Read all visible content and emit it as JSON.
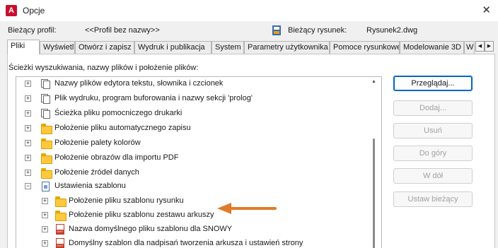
{
  "window": {
    "title": "Opcje",
    "app_icon": "A"
  },
  "profile": {
    "current_profile_label": "Bieżący profil:",
    "current_profile_value": "<<Profil bez nazwy>>",
    "current_drawing_label": "Bieżący rysunek:",
    "current_drawing_value": "Rysunek2.dwg"
  },
  "tabs": [
    "Pliki",
    "Wyświetl",
    "Otwórz i zapisz",
    "Wydruk i publikacja",
    "System",
    "Parametry użytkownika",
    "Pomoce rysunkowe",
    "Modelowanie 3D",
    "W"
  ],
  "active_tab": "Pliki",
  "panel": {
    "label": "Ścieżki wyszukiwania, nazwy plików i położenie plików:"
  },
  "tree": [
    {
      "label": "Nazwy plików edytora tekstu, słownika i czcionek",
      "icon": "doc-stack-icon",
      "level": 0,
      "expander": "+"
    },
    {
      "label": "Plik wydruku, program buforowania i nazwy sekcji 'prolog'",
      "icon": "doc-stack-icon",
      "level": 0,
      "expander": "+"
    },
    {
      "label": "Ścieżka pliku pomocniczego drukarki",
      "icon": "doc-stack-icon",
      "level": 0,
      "expander": "+"
    },
    {
      "label": "Położenie pliku automatycznego zapisu",
      "icon": "folder-icon",
      "level": 0,
      "expander": "+"
    },
    {
      "label": "Położenie palety kolorów",
      "icon": "folder-icon",
      "level": 0,
      "expander": "+"
    },
    {
      "label": "Położenie obrazów dla importu PDF",
      "icon": "folder-icon",
      "level": 0,
      "expander": "+"
    },
    {
      "label": "Położenie źródeł danych",
      "icon": "folder-icon",
      "level": 0,
      "expander": "+"
    },
    {
      "label": "Ustawienia szablonu",
      "icon": "template-doc-icon",
      "level": 0,
      "expander": "−"
    },
    {
      "label": "Położenie pliku szablonu rysunku",
      "icon": "folder-icon",
      "level": 1,
      "expander": "+"
    },
    {
      "label": "Położenie pliku szablonu zestawu arkuszy",
      "icon": "folder-icon",
      "level": 1,
      "expander": "+"
    },
    {
      "label": "Nazwa domyślnego pliku szablonu dla SNOWY",
      "icon": "dwt-file-icon",
      "level": 1,
      "expander": "+"
    },
    {
      "label": "Domyślny szablon dla nadpisań tworzenia arkusza i ustawień strony",
      "icon": "dwt-file-icon",
      "level": 1,
      "expander": "+"
    }
  ],
  "buttons": [
    {
      "label": "Przeglądaj...",
      "enabled": true
    },
    {
      "label": "Dodaj...",
      "enabled": false
    },
    {
      "label": "Usuń",
      "enabled": false
    },
    {
      "label": "Do góry",
      "enabled": false
    },
    {
      "label": "W dół",
      "enabled": false
    },
    {
      "label": "Ustaw bieżący",
      "enabled": false
    }
  ],
  "colors": {
    "arrow": "#e07b2a",
    "accent": "#0067c0",
    "app_icon": "#c8102e"
  }
}
